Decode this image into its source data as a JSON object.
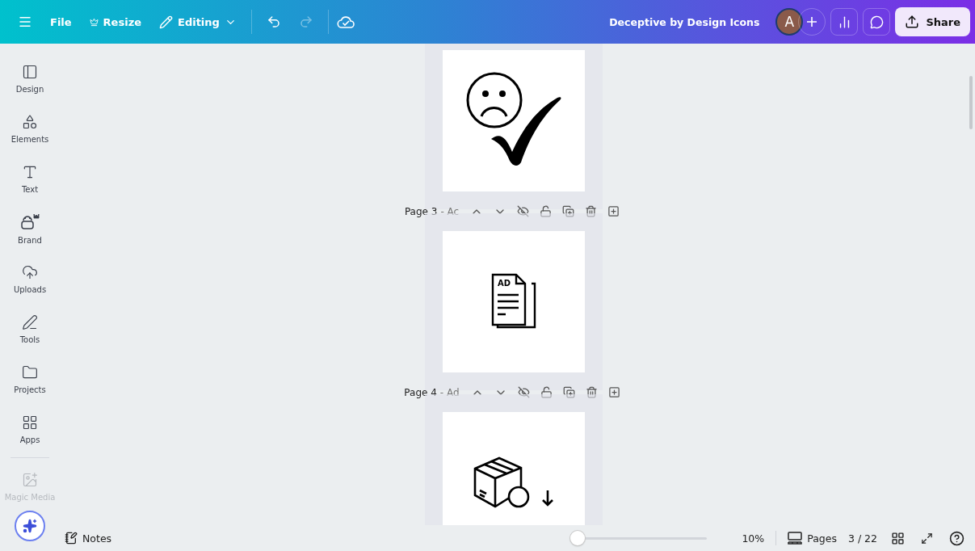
{
  "toolbar": {
    "file": "File",
    "resize": "Resize",
    "mode": "Editing",
    "undo": {
      "disabled": false
    },
    "redo": {
      "disabled": true
    },
    "title": "Deceptive by Design Icons",
    "avatar": "A",
    "share": "Share"
  },
  "sidebar": {
    "items": [
      {
        "label": "Design",
        "dimmed": false
      },
      {
        "label": "Elements",
        "dimmed": false
      },
      {
        "label": "Text",
        "dimmed": false
      },
      {
        "label": "Brand",
        "dimmed": false
      },
      {
        "label": "Uploads",
        "dimmed": false
      },
      {
        "label": "Tools",
        "dimmed": false
      },
      {
        "label": "Projects",
        "dimmed": false
      },
      {
        "label": "Apps",
        "dimmed": false
      },
      {
        "label": "Magic Media",
        "dimmed": true
      }
    ]
  },
  "pages": [
    {
      "kind": "sad-check"
    },
    {
      "title": "Page 3",
      "subtitle": "- Ac",
      "kind": "ad-document",
      "doc_text": "AD"
    },
    {
      "title": "Page 4",
      "subtitle": "- Ad",
      "kind": "box-download"
    }
  ],
  "footer": {
    "notes": "Notes",
    "zoom": {
      "level": 0.02
    },
    "zoom_reading": "10%",
    "pages": "Pages",
    "page_count": "3 / 22"
  }
}
